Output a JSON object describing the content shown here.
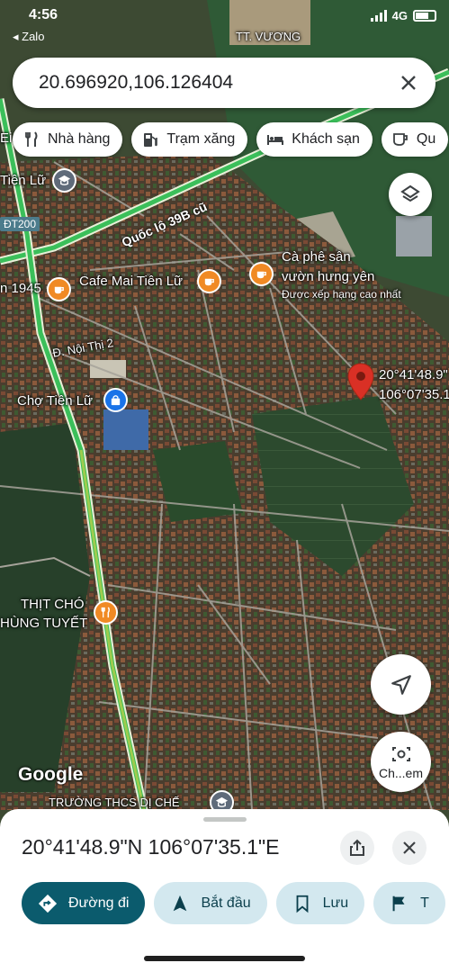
{
  "status_bar": {
    "time": "4:56",
    "back_label": "◂ Zalo",
    "signal": "4G"
  },
  "search": {
    "value": "20.696920,106.126404"
  },
  "chips": [
    {
      "label": "Nhà hàng",
      "icon": "fork-knife-icon"
    },
    {
      "label": "Trạm xăng",
      "icon": "gas-station-icon"
    },
    {
      "label": "Khách sạn",
      "icon": "bed-icon"
    },
    {
      "label": "Qu",
      "icon": "coffee-cup-icon"
    }
  ],
  "map": {
    "labels": {
      "tt_vuong": "TT. VƯƠNG",
      "tien_lu_left": "Tiên Lữ",
      "dt200": "ĐT200",
      "quoc_lo": "Quốc lộ 39B cũ",
      "cafe_1945": "n 1945",
      "cafe_mai": "Cafe Mai Tiên Lữ",
      "ca_phe_san_1": "Cà phê sân",
      "ca_phe_san_2": "vườn hưng yên",
      "ca_phe_rating": "Được xếp hạng cao nhất",
      "noi_thi": "Đ. Nội Thị 2",
      "cho_tien_lu": "Chợ Tiên Lữ",
      "pin_lat": "20°41'48.9\"",
      "pin_lng": "106°07'35.1\"",
      "thit_cho_1": "THỊT CHÓ",
      "thit_cho_2": "HÙNG TUYẾT",
      "truong": "TRƯỜNG THCS DỊ CHẾ",
      "edge_left": "Ei"
    },
    "google_logo": "Google",
    "street_view_label": "Ch...em",
    "colors": {
      "pin": "#d93025",
      "poi_food": "#f08a24",
      "poi_shop": "#1a73e8",
      "traffic_green": "#3bbf5a"
    }
  },
  "sheet": {
    "coordinates": "20°41'48.9\"N 106°07'35.1\"E",
    "actions": [
      {
        "label": "Đường đi",
        "icon": "directions-icon",
        "style": "primary"
      },
      {
        "label": "Bắt đầu",
        "icon": "navigation-arrow-icon",
        "style": "secondary"
      },
      {
        "label": "Lưu",
        "icon": "bookmark-icon",
        "style": "secondary"
      },
      {
        "label": "T",
        "icon": "flag-icon",
        "style": "secondary"
      }
    ]
  }
}
